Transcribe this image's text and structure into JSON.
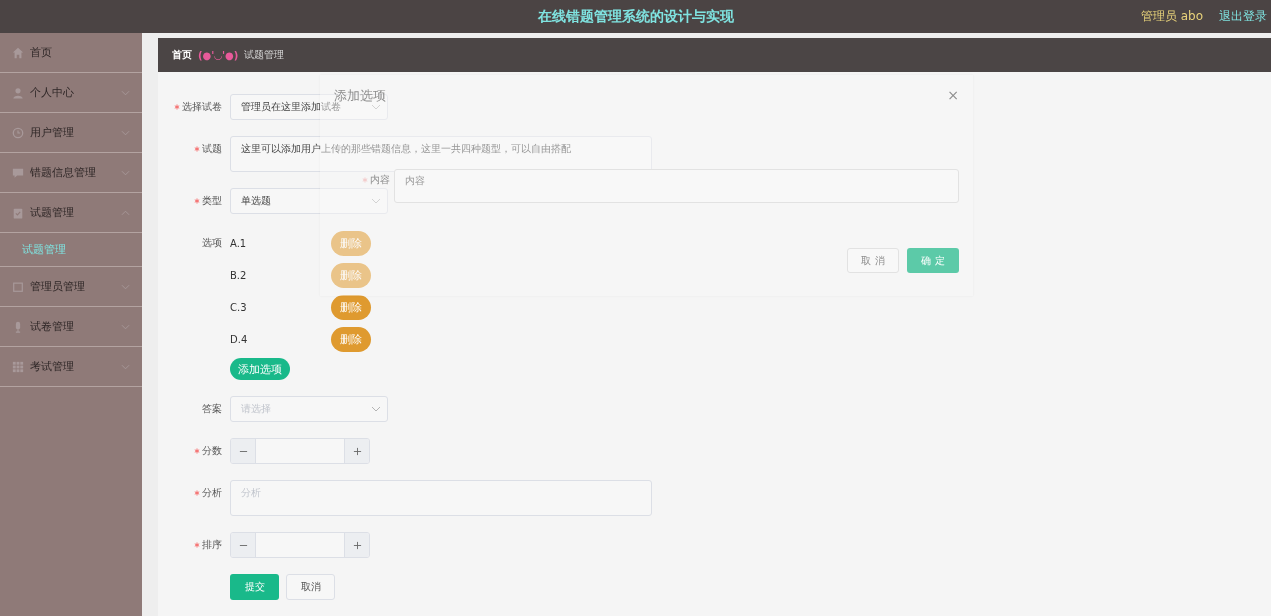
{
  "header": {
    "title": "在线错题管理系统的设计与实现",
    "user": "管理员 abo",
    "logout": "退出登录"
  },
  "sidebar": {
    "items": [
      {
        "label": "首页",
        "kind": "link"
      },
      {
        "label": "个人中心",
        "kind": "submenu",
        "expanded": false
      },
      {
        "label": "用户管理",
        "kind": "submenu",
        "expanded": false
      },
      {
        "label": "错题信息管理",
        "kind": "submenu",
        "expanded": false
      },
      {
        "label": "试题管理",
        "kind": "submenu",
        "expanded": true,
        "children": [
          {
            "label": "试题管理",
            "selected": true
          }
        ]
      },
      {
        "label": "管理员管理",
        "kind": "submenu",
        "expanded": false
      },
      {
        "label": "试卷管理",
        "kind": "submenu",
        "expanded": false
      },
      {
        "label": "考试管理",
        "kind": "submenu",
        "expanded": false
      }
    ]
  },
  "breadcrumb": {
    "home": "首页",
    "separator": "(●'◡'●)",
    "current": "试题管理"
  },
  "form": {
    "fields": [
      {
        "kind": "select",
        "label": "选择试卷",
        "required": true,
        "value": "管理员在这里添加试卷"
      },
      {
        "kind": "textarea",
        "label": "试题",
        "required": true,
        "value": "这里可以添加用户上传的那些错题信息，这里一共四种题型，可以自由搭配"
      },
      {
        "kind": "select",
        "label": "类型",
        "required": true,
        "value": "单选题"
      },
      {
        "kind": "options",
        "label": "选项",
        "required": false,
        "items": [
          {
            "label": "A.1",
            "delete": "删除"
          },
          {
            "label": "B.2",
            "delete": "删除"
          },
          {
            "label": "C.3",
            "delete": "删除"
          },
          {
            "label": "D.4",
            "delete": "删除"
          }
        ],
        "add": "添加选项"
      },
      {
        "kind": "select",
        "label": "答案",
        "required": false,
        "placeholder": "请选择"
      },
      {
        "kind": "number",
        "label": "分数",
        "required": true
      },
      {
        "kind": "textarea",
        "label": "分析",
        "required": true,
        "placeholder": "分析"
      },
      {
        "kind": "number",
        "label": "排序",
        "required": true
      }
    ],
    "buttons": {
      "submit": "提交",
      "cancel": "取消"
    }
  },
  "dialog": {
    "title": "添加选项",
    "close": "×",
    "fields": [
      {
        "label": "内容",
        "required": true,
        "placeholder": "内容"
      }
    ],
    "cancel": "取 消",
    "confirm": "确 定"
  }
}
